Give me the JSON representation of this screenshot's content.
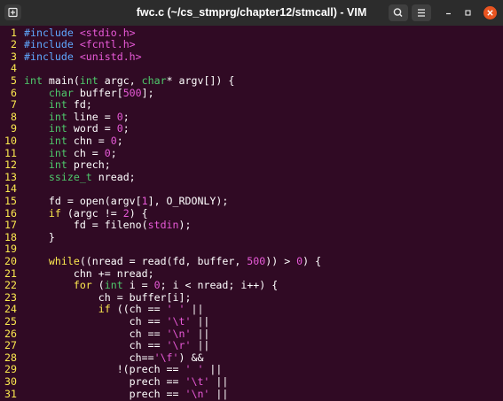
{
  "window": {
    "title": "fwc.c (~/cs_stmprg/chapter12/stmcall) - VIM"
  },
  "colors": {
    "background": "#300a24",
    "line_number": "#fce94f",
    "preprocessor": "#5fa8ff",
    "type": "#4ec96b",
    "keyword": "#fce94f",
    "literal": "#e85ad8",
    "close_button": "#e95420"
  },
  "icons": {
    "new_tab": "new-tab-icon",
    "search": "search-icon",
    "menu": "hamburger-menu-icon",
    "minimize": "minimize-icon",
    "maximize": "maximize-icon",
    "close": "close-icon"
  },
  "editor": {
    "lines": [
      {
        "num": "1",
        "segs": [
          {
            "t": "#include",
            "c": "pp"
          },
          {
            "t": " ",
            "c": ""
          },
          {
            "t": "<stdio.h>",
            "c": "inc"
          }
        ]
      },
      {
        "num": "2",
        "segs": [
          {
            "t": "#include",
            "c": "pp"
          },
          {
            "t": " ",
            "c": ""
          },
          {
            "t": "<fcntl.h>",
            "c": "inc"
          }
        ]
      },
      {
        "num": "3",
        "segs": [
          {
            "t": "#include",
            "c": "pp"
          },
          {
            "t": " ",
            "c": ""
          },
          {
            "t": "<unistd.h>",
            "c": "inc"
          }
        ]
      },
      {
        "num": "4",
        "segs": []
      },
      {
        "num": "5",
        "segs": [
          {
            "t": "int",
            "c": "ty"
          },
          {
            "t": " main(",
            "c": ""
          },
          {
            "t": "int",
            "c": "ty"
          },
          {
            "t": " argc, ",
            "c": ""
          },
          {
            "t": "char",
            "c": "ty"
          },
          {
            "t": "* argv[]) {",
            "c": ""
          }
        ]
      },
      {
        "num": "6",
        "segs": [
          {
            "t": "    ",
            "c": ""
          },
          {
            "t": "char",
            "c": "ty"
          },
          {
            "t": " buffer[",
            "c": ""
          },
          {
            "t": "500",
            "c": "lit"
          },
          {
            "t": "];",
            "c": ""
          }
        ]
      },
      {
        "num": "7",
        "segs": [
          {
            "t": "    ",
            "c": ""
          },
          {
            "t": "int",
            "c": "ty"
          },
          {
            "t": " fd;",
            "c": ""
          }
        ]
      },
      {
        "num": "8",
        "segs": [
          {
            "t": "    ",
            "c": ""
          },
          {
            "t": "int",
            "c": "ty"
          },
          {
            "t": " line = ",
            "c": ""
          },
          {
            "t": "0",
            "c": "lit"
          },
          {
            "t": ";",
            "c": ""
          }
        ]
      },
      {
        "num": "9",
        "segs": [
          {
            "t": "    ",
            "c": ""
          },
          {
            "t": "int",
            "c": "ty"
          },
          {
            "t": " word = ",
            "c": ""
          },
          {
            "t": "0",
            "c": "lit"
          },
          {
            "t": ";",
            "c": ""
          }
        ]
      },
      {
        "num": "10",
        "segs": [
          {
            "t": "    ",
            "c": ""
          },
          {
            "t": "int",
            "c": "ty"
          },
          {
            "t": " chn = ",
            "c": ""
          },
          {
            "t": "0",
            "c": "lit"
          },
          {
            "t": ";",
            "c": ""
          }
        ]
      },
      {
        "num": "11",
        "segs": [
          {
            "t": "    ",
            "c": ""
          },
          {
            "t": "int",
            "c": "ty"
          },
          {
            "t": " ch = ",
            "c": ""
          },
          {
            "t": "0",
            "c": "lit"
          },
          {
            "t": ";",
            "c": ""
          }
        ]
      },
      {
        "num": "12",
        "segs": [
          {
            "t": "    ",
            "c": ""
          },
          {
            "t": "int",
            "c": "ty"
          },
          {
            "t": " prech;",
            "c": ""
          }
        ]
      },
      {
        "num": "13",
        "segs": [
          {
            "t": "    ",
            "c": ""
          },
          {
            "t": "ssize_t",
            "c": "ty"
          },
          {
            "t": " nread;",
            "c": ""
          }
        ]
      },
      {
        "num": "14",
        "segs": []
      },
      {
        "num": "15",
        "segs": [
          {
            "t": "    fd = open(argv[",
            "c": ""
          },
          {
            "t": "1",
            "c": "lit"
          },
          {
            "t": "], O_RDONLY);",
            "c": ""
          }
        ]
      },
      {
        "num": "16",
        "segs": [
          {
            "t": "    ",
            "c": ""
          },
          {
            "t": "if",
            "c": "kw"
          },
          {
            "t": " (argc != ",
            "c": ""
          },
          {
            "t": "2",
            "c": "lit"
          },
          {
            "t": ") {",
            "c": ""
          }
        ]
      },
      {
        "num": "17",
        "segs": [
          {
            "t": "        fd = fileno(",
            "c": ""
          },
          {
            "t": "stdin",
            "c": "lit"
          },
          {
            "t": ");",
            "c": ""
          }
        ]
      },
      {
        "num": "18",
        "segs": [
          {
            "t": "    }",
            "c": ""
          }
        ]
      },
      {
        "num": "19",
        "segs": []
      },
      {
        "num": "20",
        "segs": [
          {
            "t": "    ",
            "c": ""
          },
          {
            "t": "while",
            "c": "kw"
          },
          {
            "t": "((nread = read(fd, buffer, ",
            "c": ""
          },
          {
            "t": "500",
            "c": "lit"
          },
          {
            "t": ")) > ",
            "c": ""
          },
          {
            "t": "0",
            "c": "lit"
          },
          {
            "t": ") {",
            "c": ""
          }
        ]
      },
      {
        "num": "21",
        "segs": [
          {
            "t": "        chn += nread;",
            "c": ""
          }
        ]
      },
      {
        "num": "22",
        "segs": [
          {
            "t": "        ",
            "c": ""
          },
          {
            "t": "for",
            "c": "kw"
          },
          {
            "t": " (",
            "c": ""
          },
          {
            "t": "int",
            "c": "ty"
          },
          {
            "t": " i = ",
            "c": ""
          },
          {
            "t": "0",
            "c": "lit"
          },
          {
            "t": "; i < nread; i++) {",
            "c": ""
          }
        ]
      },
      {
        "num": "23",
        "segs": [
          {
            "t": "            ch = buffer[i];",
            "c": ""
          }
        ]
      },
      {
        "num": "24",
        "segs": [
          {
            "t": "            ",
            "c": ""
          },
          {
            "t": "if",
            "c": "kw"
          },
          {
            "t": " ((ch == ",
            "c": ""
          },
          {
            "t": "' '",
            "c": "lit"
          },
          {
            "t": " ||",
            "c": ""
          }
        ]
      },
      {
        "num": "25",
        "segs": [
          {
            "t": "                 ch == ",
            "c": ""
          },
          {
            "t": "'\\t'",
            "c": "lit"
          },
          {
            "t": " ||",
            "c": ""
          }
        ]
      },
      {
        "num": "26",
        "segs": [
          {
            "t": "                 ch == ",
            "c": ""
          },
          {
            "t": "'\\n'",
            "c": "lit"
          },
          {
            "t": " ||",
            "c": ""
          }
        ]
      },
      {
        "num": "27",
        "segs": [
          {
            "t": "                 ch == ",
            "c": ""
          },
          {
            "t": "'\\r'",
            "c": "lit"
          },
          {
            "t": " ||",
            "c": ""
          }
        ]
      },
      {
        "num": "28",
        "segs": [
          {
            "t": "                 ch==",
            "c": ""
          },
          {
            "t": "'\\f'",
            "c": "lit"
          },
          {
            "t": ") &&",
            "c": ""
          }
        ]
      },
      {
        "num": "29",
        "segs": [
          {
            "t": "               !(prech == ",
            "c": ""
          },
          {
            "t": "' '",
            "c": "lit"
          },
          {
            "t": " ||",
            "c": ""
          }
        ]
      },
      {
        "num": "30",
        "segs": [
          {
            "t": "                 prech == ",
            "c": ""
          },
          {
            "t": "'\\t'",
            "c": "lit"
          },
          {
            "t": " ||",
            "c": ""
          }
        ]
      },
      {
        "num": "31",
        "segs": [
          {
            "t": "                 prech == ",
            "c": ""
          },
          {
            "t": "'\\n'",
            "c": "lit"
          },
          {
            "t": " ||",
            "c": ""
          }
        ]
      }
    ]
  }
}
